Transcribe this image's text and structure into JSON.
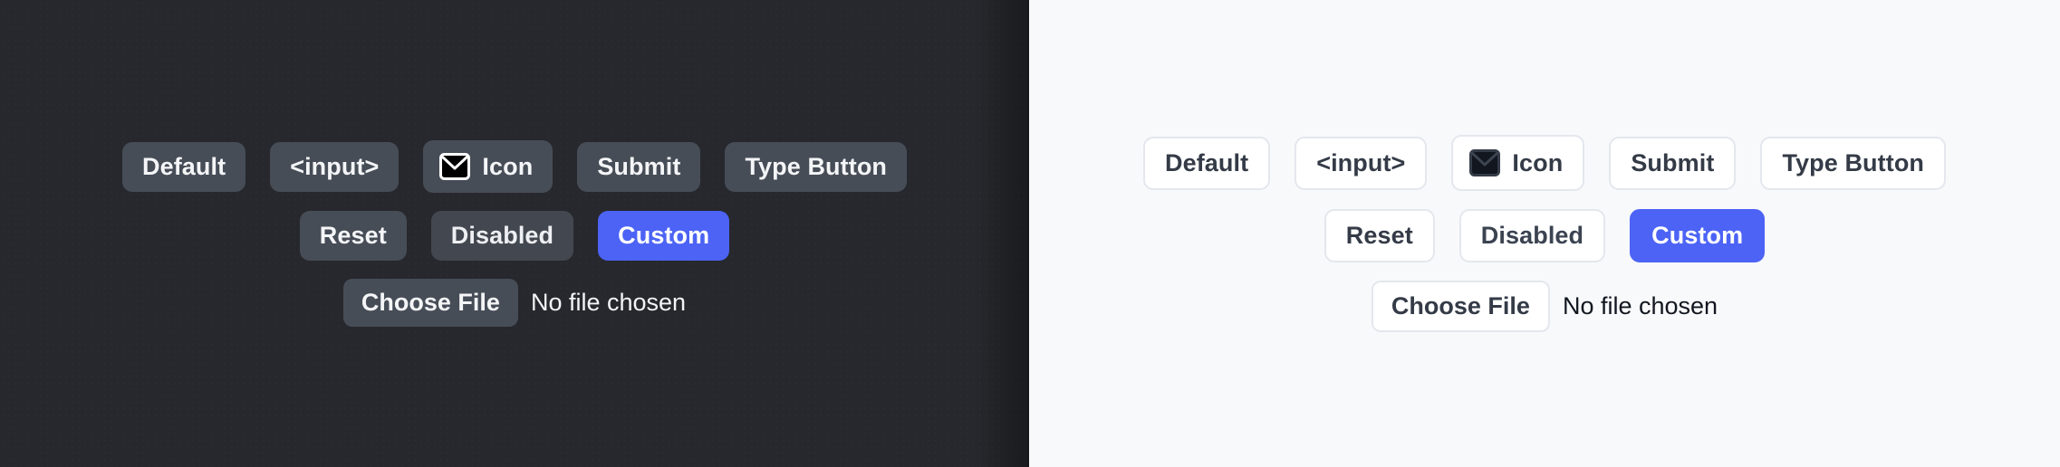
{
  "themes": {
    "dark": {
      "name": "dark-panel",
      "background": "#26282d",
      "button_bg": "#474d57",
      "button_text": "#f4f5f7",
      "accent": "#4c63f5"
    },
    "light": {
      "name": "light-panel",
      "background": "#f8f9fb",
      "button_bg": "#ffffff",
      "button_border": "#e4e7ed",
      "button_text": "#343b47",
      "accent": "#4c63f5"
    }
  },
  "buttons": {
    "default": "Default",
    "input": "<input>",
    "icon": "Icon",
    "icon_glyph": "envelope-icon",
    "submit": "Submit",
    "type_button": "Type Button",
    "reset": "Reset",
    "disabled": "Disabled",
    "custom": "Custom"
  },
  "file_input": {
    "choose_label": "Choose File",
    "status": "No file chosen"
  }
}
